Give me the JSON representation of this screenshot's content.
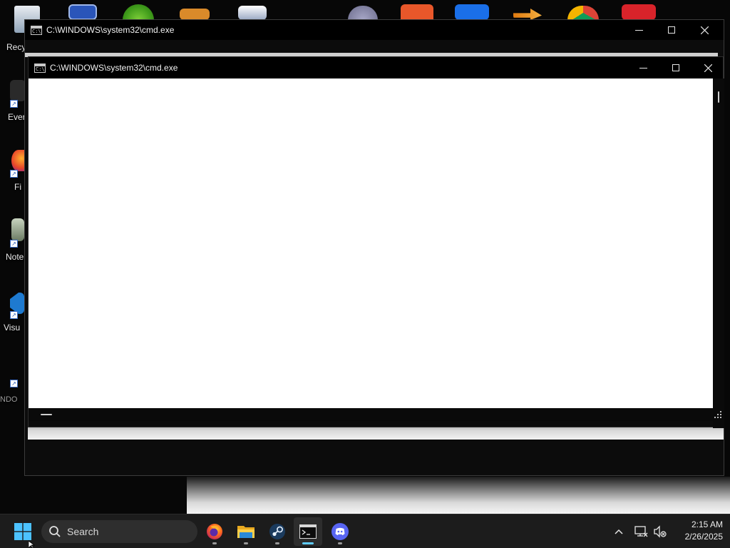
{
  "desktop": {
    "icon_labels": {
      "recycle_bin": "Recy",
      "everything": "Ever",
      "firefox": "Fi",
      "notepad": "Note",
      "vscode": "Visu",
      "window_bit": "NDO"
    }
  },
  "windows": {
    "back": {
      "title": "C:\\WINDOWS\\system32\\cmd.exe",
      "icon": "cmd-icon"
    },
    "front": {
      "title": "C:\\WINDOWS\\system32\\cmd.exe",
      "icon": "cmd-icon"
    }
  },
  "taskbar": {
    "search_label": "Search",
    "apps": [
      {
        "name": "start",
        "icon": "windows-logo-icon"
      },
      {
        "name": "firefox",
        "icon": "firefox-icon"
      },
      {
        "name": "file-explorer",
        "icon": "folder-icon"
      },
      {
        "name": "steam",
        "icon": "steam-icon"
      },
      {
        "name": "terminal",
        "icon": "terminal-icon",
        "active": true
      },
      {
        "name": "discord",
        "icon": "discord-icon"
      }
    ],
    "clock": {
      "time": "2:15 AM",
      "date": "2/26/2025"
    }
  },
  "colors": {
    "accent": "#60cdff",
    "titlebar": "#000000",
    "taskbar": "#1c1c1c",
    "console_bg": "#ffffff"
  }
}
